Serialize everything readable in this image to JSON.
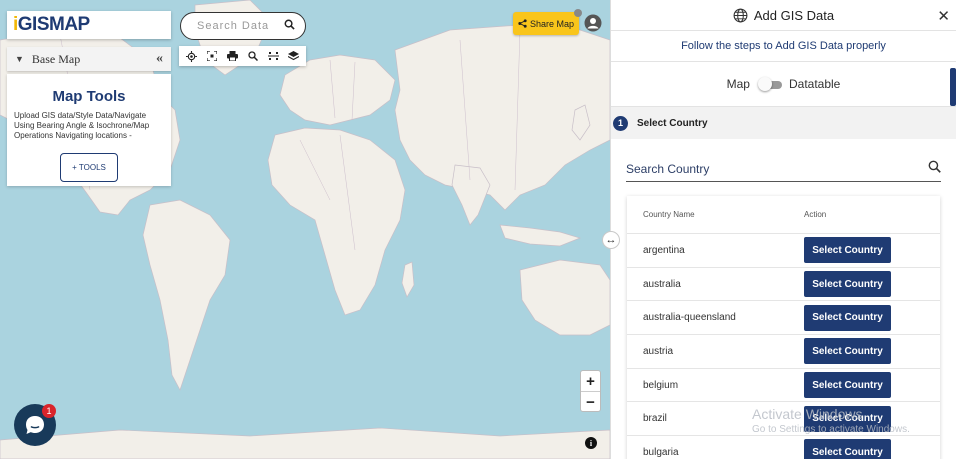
{
  "brand": {
    "logo_i": "i",
    "logo_rest": "GISMAP"
  },
  "base_map": {
    "label": "Base Map",
    "collapse": "«"
  },
  "tools_card": {
    "title": "Map Tools",
    "description": "Upload GIS data/Style Data/Navigate Using Bearing Angle & Isochrone/Map Operations Navigating locations -",
    "button": "+ TOOLS"
  },
  "search": {
    "placeholder": "Search Data"
  },
  "toolbar": {
    "icons": [
      "locate-icon",
      "fullscreen-icon",
      "print-icon",
      "zoom-search-icon",
      "measure-icon",
      "layers-icon"
    ]
  },
  "share": {
    "label": "Share Map"
  },
  "zoom": {
    "in": "+",
    "out": "−"
  },
  "info": {
    "symbol": "i"
  },
  "chat": {
    "badge": "1"
  },
  "panel": {
    "title": "Add GIS Data",
    "subtitle": "Follow the steps to Add GIS Data properly",
    "toggle_left": "Map",
    "toggle_right": "Datatable",
    "step_number": "1",
    "step_label": "Select Country",
    "country_search_placeholder": "Search Country",
    "table": {
      "col_country": "Country Name",
      "col_action": "Action",
      "action_label": "Select Country",
      "rows": [
        "argentina",
        "australia",
        "australia-queensland",
        "austria",
        "belgium",
        "brazil",
        "bulgaria"
      ]
    }
  },
  "watermark": {
    "line1": "Activate Windows",
    "line2": "Go to Settings to activate Windows."
  },
  "colors": {
    "brand_navy": "#1f3b73",
    "accent_yellow": "#f9c51b",
    "ocean": "#aad3df",
    "land": "#f2efe9"
  }
}
